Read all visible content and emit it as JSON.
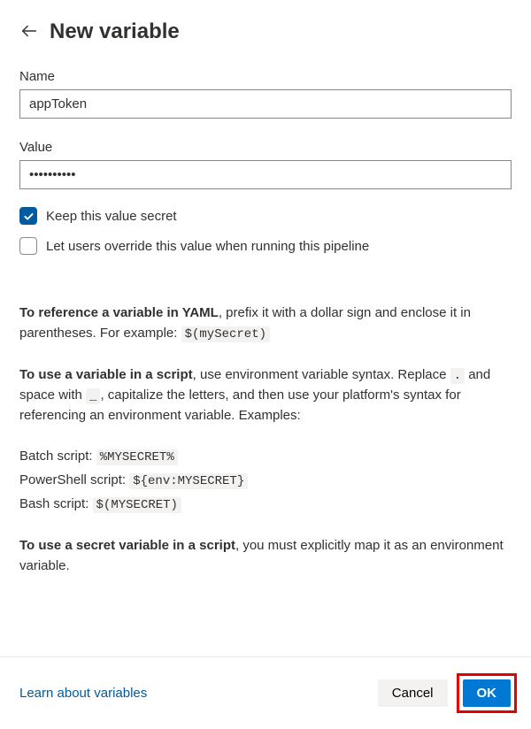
{
  "header": {
    "title": "New variable"
  },
  "fields": {
    "name": {
      "label": "Name",
      "value": "appToken"
    },
    "value": {
      "label": "Value",
      "value": "••••••••••"
    }
  },
  "options": {
    "secret": {
      "label": "Keep this value secret",
      "checked": true
    },
    "override": {
      "label": "Let users override this value when running this pipeline",
      "checked": false
    }
  },
  "help": {
    "ref_yaml_prefix": "To reference a variable in YAML",
    "ref_yaml_rest": ", prefix it with a dollar sign and enclose it in parentheses. For example: ",
    "ref_yaml_code": "$(mySecret)",
    "use_script_prefix": "To use a variable in a script",
    "use_script_1": ", use environment variable syntax. Replace ",
    "dot_code": ".",
    "use_script_2": " and space with ",
    "under_code": "_",
    "use_script_3": ", capitalize the letters, and then use your platform's syntax for referencing an environment variable. Examples:",
    "batch_label": "Batch script: ",
    "batch_code": "%MYSECRET%",
    "ps_label": "PowerShell script: ",
    "ps_code": "${env:MYSECRET}",
    "bash_label": "Bash script: ",
    "bash_code": "$(MYSECRET)",
    "secret_prefix": "To use a secret variable in a script",
    "secret_rest": ", you must explicitly map it as an environment variable."
  },
  "footer": {
    "learn": "Learn about variables",
    "cancel": "Cancel",
    "ok": "OK"
  }
}
